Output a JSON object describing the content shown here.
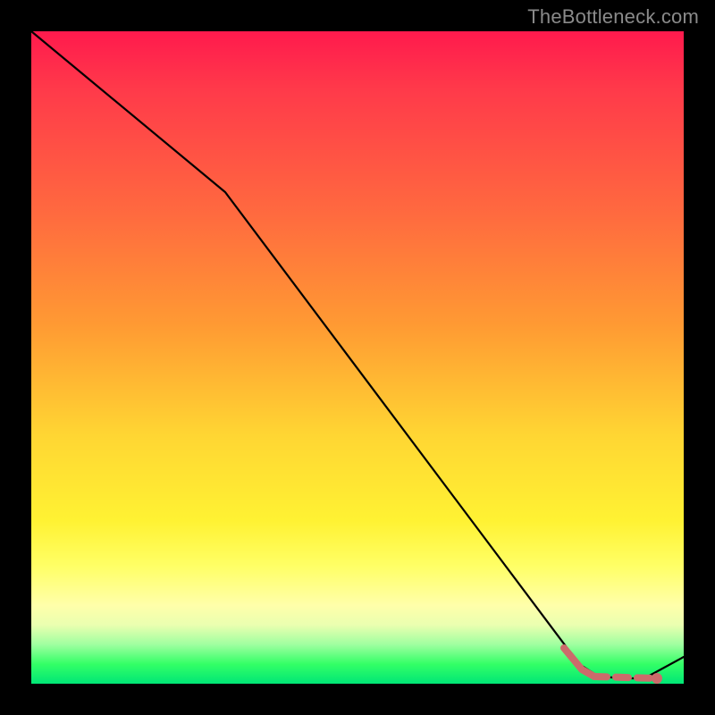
{
  "watermark": "TheBottleneck.com",
  "chart_data": {
    "type": "line",
    "title": "",
    "xlabel": "",
    "ylabel": "",
    "xlim": [
      0,
      100
    ],
    "ylim": [
      0,
      100
    ],
    "grid": false,
    "legend": false,
    "series": [
      {
        "name": "bottleneck-curve",
        "color": "#000000",
        "style": "solid",
        "x": [
          0,
          30,
          84,
          87,
          91,
          94,
          100
        ],
        "y": [
          100,
          75,
          3,
          1,
          1,
          1,
          4
        ]
      },
      {
        "name": "highlight-segment",
        "color": "#cc6b6b",
        "style": "dashed",
        "x": [
          82,
          84,
          87,
          90,
          93,
          96
        ],
        "y": [
          5,
          3,
          1,
          1,
          1,
          1
        ]
      }
    ],
    "markers": [
      {
        "name": "highlight-dot",
        "x": 96,
        "y": 1,
        "color": "#cc6b6b"
      }
    ]
  }
}
